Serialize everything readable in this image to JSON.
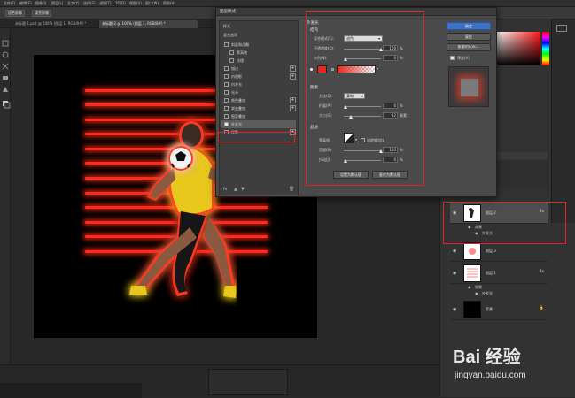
{
  "menubar": {
    "items": [
      "文件(F)",
      "编辑(E)",
      "图像(I)",
      "图层(L)",
      "文字(Y)",
      "选择(S)",
      "滤镜(T)",
      "3D(D)",
      "视图(V)",
      "窗口(W)",
      "帮助(H)"
    ]
  },
  "options": {
    "btn_fit": "适合屏幕",
    "btn_fill": "填充屏幕"
  },
  "tabs": [
    {
      "label": "未标题-1.psd @ 100% (图层 1, RGB/8#) *"
    },
    {
      "label": "未标题-2 @ 100% (图层 2, RGB/8#) *"
    }
  ],
  "dialog": {
    "title": "图层样式",
    "left": {
      "header": "样式",
      "blend": "混合选项",
      "items": [
        {
          "label": "斜面和浮雕",
          "checked": false,
          "plus": false
        },
        {
          "label": "等高线",
          "checked": false,
          "plus": false
        },
        {
          "label": "纹理",
          "checked": false,
          "plus": false
        },
        {
          "label": "描边",
          "checked": false,
          "plus": true
        },
        {
          "label": "内阴影",
          "checked": false,
          "plus": true
        },
        {
          "label": "内发光",
          "checked": false,
          "plus": false
        },
        {
          "label": "光泽",
          "checked": false,
          "plus": false
        },
        {
          "label": "颜色叠加",
          "checked": false,
          "plus": true
        },
        {
          "label": "渐变叠加",
          "checked": false,
          "plus": true
        },
        {
          "label": "图案叠加",
          "checked": false,
          "plus": false
        },
        {
          "label": "外发光",
          "checked": true,
          "plus": false
        },
        {
          "label": "投影",
          "checked": false,
          "plus": true
        }
      ],
      "fx_label": "fx"
    },
    "main": {
      "title": "外发光",
      "structure": "结构",
      "blend_mode_label": "混合模式(E):",
      "blend_mode_value": "滤色",
      "opacity_label": "不透明度(O):",
      "opacity_value": "100",
      "opacity_unit": "%",
      "noise_label": "杂色(N):",
      "noise_value": "0",
      "noise_unit": "%",
      "elements": "图素",
      "method_label": "方法(Q):",
      "method_value": "柔和",
      "spread_label": "扩展(P):",
      "spread_value": "0",
      "spread_unit": "%",
      "size_label": "大小(S):",
      "size_value": "32",
      "size_unit": "像素",
      "quality": "品质",
      "contour_label": "等高线:",
      "antialias_label": "消除锯齿(L)",
      "range_label": "范围(R):",
      "range_value": "100",
      "range_unit": "%",
      "jitter_label": "抖动(J):",
      "jitter_value": "0",
      "jitter_unit": "%",
      "btn_default": "设置为默认值",
      "btn_reset": "复位为默认值"
    },
    "right": {
      "ok": "确定",
      "reset": "复位",
      "new_style": "新建样式(W)...",
      "preview": "预览(V)"
    }
  },
  "colors": {
    "glow": "#ff2a1e",
    "swatch": "#e8271c",
    "accent": "#3d71c8",
    "annotation": "#e02424"
  },
  "layers": [
    {
      "name": "图层 2",
      "has_fx": true,
      "fx_mark": "fx",
      "effects_label": "效果",
      "effect": "外发光",
      "selected": true
    },
    {
      "name": "图层 3",
      "has_fx": false
    },
    {
      "name": "图层 1",
      "has_fx": true,
      "fx_mark": "fx",
      "effects_label": "效果",
      "effect": "外发光",
      "selected": false
    },
    {
      "name": "背景",
      "has_fx": false
    }
  ],
  "watermark": {
    "brand": "Bai 经验",
    "url": "jingyan.baidu.com"
  }
}
